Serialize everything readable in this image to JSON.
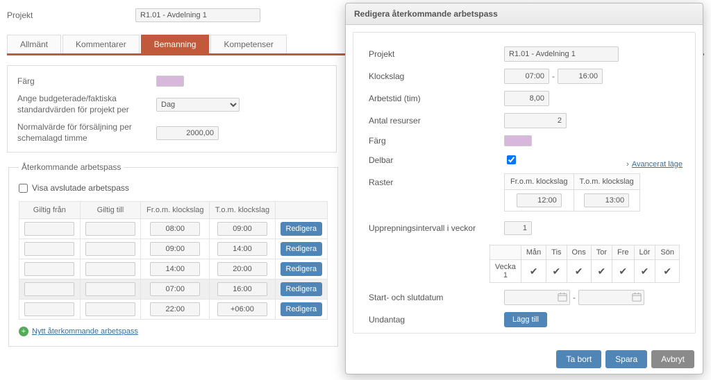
{
  "page": {
    "project_label": "Projekt",
    "project_value": "R1.01 - Avdelning 1",
    "tabs": {
      "allmant": "Allmänt",
      "kommentarer": "Kommentarer",
      "bemanning": "Bemanning",
      "kompetenser": "Kompetenser"
    },
    "settings": {
      "color_label": "Färg",
      "budget_label": "Ange budgeterade/faktiska standardvärden för projekt per",
      "budget_select": "Dag",
      "normal_label": "Normalvärde för försäljning per schemalagd timme",
      "normal_value": "2000,00"
    },
    "recurring": {
      "legend": "Återkommande arbetspass",
      "show_closed": "Visa avslutade arbetspass",
      "cols": {
        "from": "Giltig från",
        "to": "Giltig till",
        "time_from": "Fr.o.m. klockslag",
        "time_to": "T.o.m. klockslag"
      },
      "rows": [
        {
          "t1": "08:00",
          "t2": "09:00"
        },
        {
          "t1": "09:00",
          "t2": "14:00"
        },
        {
          "t1": "14:00",
          "t2": "20:00"
        },
        {
          "t1": "07:00",
          "t2": "16:00"
        },
        {
          "t1": "22:00",
          "t2": "+06:00"
        }
      ],
      "edit_btn": "Redigera",
      "add_link": "Nytt återkommande arbetspass"
    }
  },
  "modal": {
    "title": "Redigera återkommande arbetspass",
    "project_label": "Projekt",
    "project_value": "R1.01 - Avdelning 1",
    "klockslag_label": "Klockslag",
    "time_from": "07:00",
    "time_to": "16:00",
    "arbetstid_label": "Arbetstid (tim)",
    "arbetstid_value": "8,00",
    "resurser_label": "Antal resurser",
    "resurser_value": "2",
    "color_label": "Färg",
    "delbar_label": "Delbar",
    "raster_label": "Raster",
    "raster_cols": {
      "from": "Fr.o.m. klockslag",
      "to": "T.o.m. klockslag"
    },
    "raster_from": "12:00",
    "raster_to": "13:00",
    "adv_link": "Avancerat läge",
    "interval_label": "Upprepningsintervall i veckor",
    "interval_value": "1",
    "days": {
      "mon": "Mån",
      "tue": "Tis",
      "wed": "Ons",
      "thu": "Tor",
      "fri": "Fre",
      "sat": "Lör",
      "sun": "Sön"
    },
    "week1": "Vecka 1",
    "startend_label": "Start- och slutdatum",
    "undantag_label": "Undantag",
    "add_btn": "Lägg till",
    "footer": {
      "delete": "Ta bort",
      "save": "Spara",
      "cancel": "Avbryt"
    }
  },
  "colors": {
    "swatch": "#d8b7dc"
  }
}
